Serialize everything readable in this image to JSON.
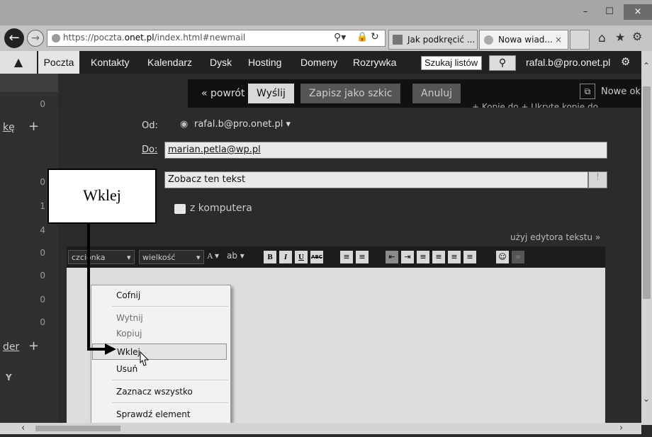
{
  "browser": {
    "url_prefix": "https://poczta.",
    "url_domain": "onet.pl",
    "url_suffix": "/index.html#newmail",
    "tabs": [
      {
        "label": "Jak podkręcić ..."
      },
      {
        "label": "Nowa wiad...",
        "close": "×"
      }
    ],
    "window_buttons": {
      "min": "–",
      "max": "☐",
      "close": "×"
    }
  },
  "nav": {
    "items": [
      "Poczta",
      "Kontakty",
      "Kalendarz",
      "Dysk",
      "Hosting",
      "Domeny",
      "Rozrywka"
    ],
    "search_placeholder": "Szukaj listów",
    "account": "rafal.b@pro.onet.pl"
  },
  "sidebar": {
    "counts": [
      "0",
      "0",
      "1",
      "4",
      "0",
      "0",
      "0",
      "0"
    ],
    "link1": "kę",
    "link2": "der",
    "plus": "+",
    "y": "Y"
  },
  "compose": {
    "back": "« powrót",
    "send": "Wyślij",
    "draft": "Zapisz jako szkic",
    "cancel": "Anuluj",
    "new_window": "Nowe ok",
    "cc_links": "+ Kopie do    + Ukryte kopie do",
    "from_label": "Od:",
    "from_value": "rafal.b@pro.onet.pl",
    "to_label": "Do:",
    "to_value": "marian.petla@wp.pl",
    "subject_value": "Zobacz ten tekst",
    "attach": "z komputera",
    "use_editor": "użyj edytora tekstu »"
  },
  "editor": {
    "font_select": "czcionka",
    "size_select": "wielkość",
    "buttons": {
      "bold": "B",
      "italic": "I",
      "underline": "U",
      "strike": "ABC"
    }
  },
  "context_menu": {
    "items": [
      "Cofnij",
      "Wytnij",
      "Kopiuj",
      "Wklej",
      "Usuń",
      "Zaznacz wszystko",
      "Sprawdź element"
    ]
  },
  "callout": {
    "text": "Wklej"
  }
}
